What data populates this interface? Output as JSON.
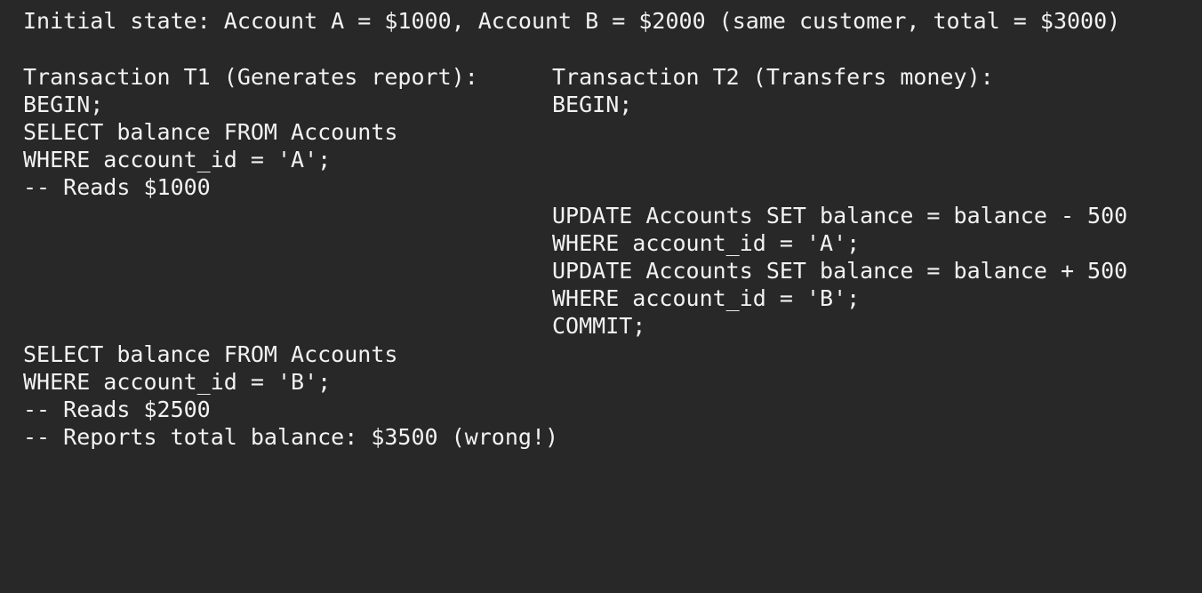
{
  "initial_state": "Initial state: Account A = $1000, Account B = $2000 (same customer, total = $3000)",
  "t1": {
    "header": "Transaction T1 (Generates report):",
    "lines": [
      "BEGIN;",
      "SELECT balance FROM Accounts",
      "WHERE account_id = 'A';",
      "-- Reads $1000",
      "SELECT balance FROM Accounts",
      "WHERE account_id = 'B';",
      "-- Reads $2500",
      "-- Reports total balance: $3500 (wrong!)"
    ]
  },
  "t2": {
    "header": "Transaction T2 (Transfers money):",
    "lines": [
      "BEGIN;",
      "UPDATE Accounts SET balance = balance - 500",
      "WHERE account_id = 'A';",
      "UPDATE Accounts SET balance = balance + 500",
      "WHERE account_id = 'B';",
      "COMMIT;"
    ]
  }
}
